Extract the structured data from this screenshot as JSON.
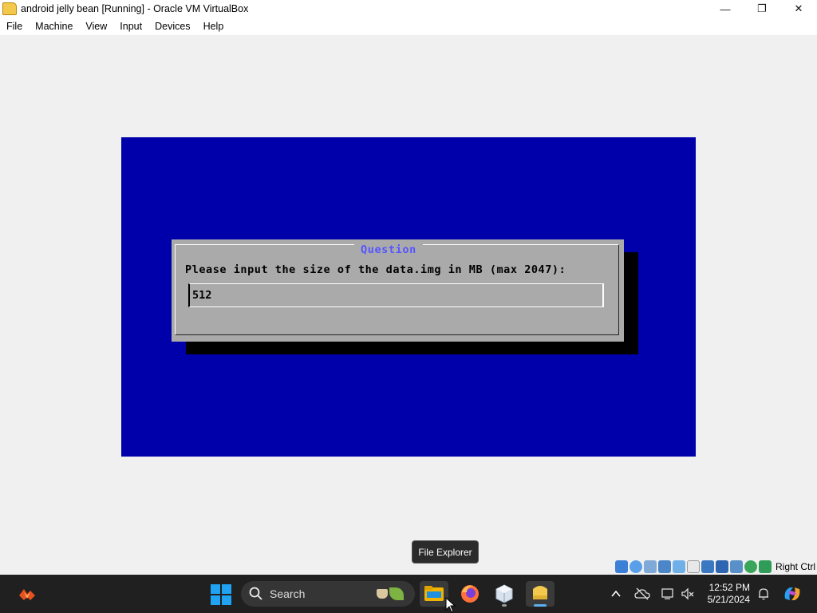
{
  "window": {
    "title": "android jelly bean [Running] - Oracle VM VirtualBox",
    "minimize": "—",
    "maximize": "❐",
    "close": "✕"
  },
  "menu": [
    "File",
    "Machine",
    "View",
    "Input",
    "Devices",
    "Help"
  ],
  "dialog": {
    "title": "Question",
    "prompt": "Please input the size of the data.img in MB (max 2047):",
    "input_value": "512"
  },
  "statusbar": {
    "host_key": "Right Ctrl"
  },
  "tooltip": "File Explorer",
  "taskbar": {
    "search_label": "Search",
    "time": "12:52 PM",
    "date": "5/21/2024"
  },
  "colors": {
    "vm_background": "#0000aa",
    "dialog_gray": "#aaaaaa",
    "dialog_title": "#5555ff",
    "taskbar": "#202020"
  }
}
